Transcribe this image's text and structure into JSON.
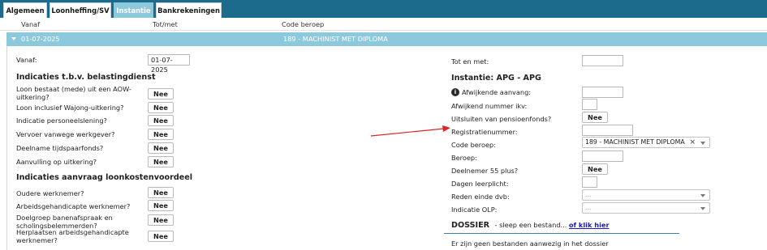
{
  "tabs": [
    {
      "label": "Algemeen"
    },
    {
      "label": "Loonheffing/SV"
    },
    {
      "label": "Instantie",
      "active": true
    },
    {
      "label": "Bankrekeningen"
    }
  ],
  "columns": {
    "vanaf": "Vanaf",
    "totmet": "Tot/met",
    "code_beroep": "Code beroep"
  },
  "row": {
    "date": "01-07-2025",
    "code": "189 - MACHINIST MET DIPLOMA"
  },
  "left": {
    "vanaf_label": "Vanaf:",
    "vanaf_value": "01-07-2025",
    "section1_title": "Indicaties t.b.v. belastingdienst",
    "section1_items": [
      {
        "label": "Loon bestaat (mede) uit een AOW-uitkering?",
        "value": "Nee"
      },
      {
        "label": "Loon inclusief Wajong-uitkering?",
        "value": "Nee"
      },
      {
        "label": "Indicatie personeelslening?",
        "value": "Nee"
      },
      {
        "label": "Vervoer vanwege werkgever?",
        "value": "Nee"
      },
      {
        "label": "Deelname tijdspaarfonds?",
        "value": "Nee"
      },
      {
        "label": "Aanvulling op uitkering?",
        "value": "Nee"
      }
    ],
    "section2_title": "Indicaties aanvraag loonkostenvoordeel",
    "section2_items": [
      {
        "label": "Oudere werknemer?",
        "value": "Nee"
      },
      {
        "label": "Arbeidsgehandicapte werknemer?",
        "value": "Nee"
      },
      {
        "label": "Doelgroep banenafspraak en scholingsbelemmerden?",
        "value": "Nee"
      },
      {
        "label": "Herplaatsen arbeidsgehandicapte werknemer?",
        "value": "Nee"
      }
    ]
  },
  "right": {
    "totmet_label": "Tot en met:",
    "totmet_value": "",
    "instantie_title": "Instantie: APG - APG",
    "afwijkende_aanvang": "Afwijkende aanvang:",
    "afwijkend_nummer": "Afwijkend nummer ikv:",
    "uitsluiten_label": "Uitsluiten van pensioenfonds?",
    "uitsluiten_value": "Nee",
    "registratie_label": "Registratienummer:",
    "code_beroep_label": "Code beroep:",
    "code_beroep_value": "189 - MACHINIST MET DIPLOMA",
    "beroep_label": "Beroep:",
    "deelnemer_label": "Deelnemer 55 plus?",
    "deelnemer_value": "Nee",
    "dagen_label": "Dagen leerplicht:",
    "reden_label": "Reden einde dvb:",
    "reden_placeholder": "...",
    "olp_label": "Indicatie OLP:",
    "olp_placeholder": "...",
    "dossier_title": "DOSSIER",
    "dossier_hint": "- sleep een bestand...",
    "dossier_link": "of klik hier",
    "dossier_empty": "Er zijn geen bestanden aanwezig in het dossier"
  },
  "colors": {
    "tabbar": "#1d6b8c",
    "accent": "#8cc9dc",
    "arrow": "#d9262b"
  }
}
